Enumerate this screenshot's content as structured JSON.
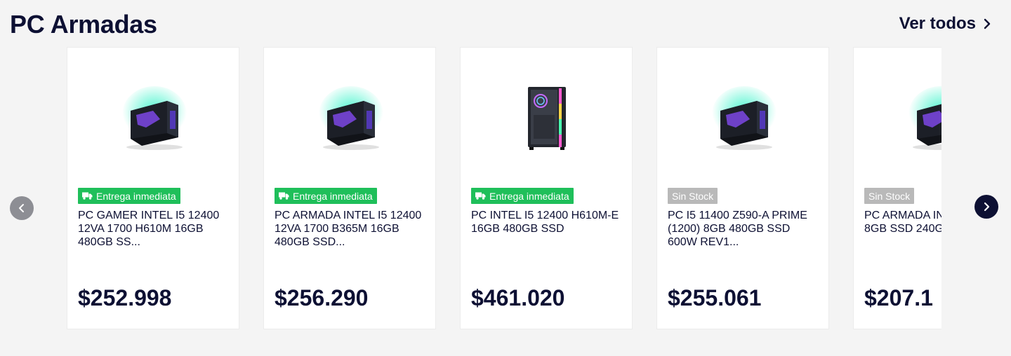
{
  "section": {
    "title": "PC Armadas",
    "see_all": "Ver todos"
  },
  "icons": {
    "prev": "chevron-left-icon",
    "next": "chevron-right-icon",
    "see_all": "chevron-right-icon",
    "delivery": "truck-icon"
  },
  "colors": {
    "text": "#0d1033",
    "in_stock_badge": "#1fbf5a",
    "out_of_stock_badge": "#b9b9b9",
    "next_button": "#0d1033",
    "prev_button": "#8d8e94"
  },
  "products": [
    {
      "badge": "Entrega inmediata",
      "badge_type": "in-stock",
      "name": "PC GAMER INTEL I5 12400\n12VA 1700 H610M 16GB\n480GB SS...",
      "price": "$252.998",
      "image": "gaming-pc-neon"
    },
    {
      "badge": "Entrega inmediata",
      "badge_type": "in-stock",
      "name": "PC ARMADA INTEL I5 12400\n12VA 1700 B365M 16GB\n480GB SSD...",
      "price": "$256.290",
      "image": "gaming-pc-neon"
    },
    {
      "badge": "Entrega inmediata",
      "badge_type": "in-stock",
      "name": "PC INTEL I5 12400 H610M-E\n16GB 480GB SSD",
      "price": "$461.020",
      "image": "tower-case-rgb"
    },
    {
      "badge": "Sin Stock",
      "badge_type": "out-of-stock",
      "name": "PC I5 11400 Z590-A PRIME\n(1200) 8GB 480GB SSD\n600W REV1...",
      "price": "$255.061",
      "image": "gaming-pc-neon"
    },
    {
      "badge": "Sin Stock",
      "badge_type": "out-of-stock",
      "name": "PC ARMADA IN\n8GB SSD 240G",
      "price": "$207.1",
      "image": "gaming-pc-neon"
    }
  ]
}
